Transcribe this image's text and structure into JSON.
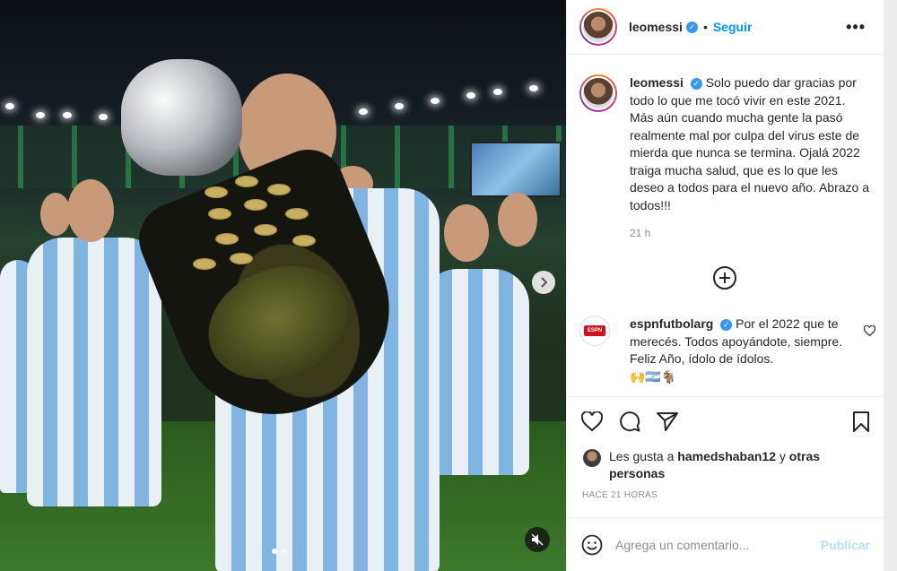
{
  "post": {
    "username": "leomessi",
    "follow_label": "Seguir",
    "bullet": "•",
    "more_label": "•••",
    "caption": "Solo puedo dar gracias por todo lo que me tocó vivir en este 2021. Más aún cuando mucha gente la pasó realmente mal por culpa del virus este de mierda que nunca se termina. Ojalá 2022 traiga mucha salud, que es lo que les deseo a todos para el nuevo año. Abrazo a todos!!!",
    "caption_time": "21 h"
  },
  "comment": {
    "username": "espnfutbolarg",
    "text": "Por el 2022 que te merecés. Todos apoyándote, siempre. Feliz Año, ídolo de ídolos.",
    "emojis": "🙌🇦🇷🐐",
    "logo_text": "ESPN"
  },
  "likes": {
    "prefix": "Les gusta a",
    "user": "hamedshaban12",
    "and": "y",
    "others": "otras personas"
  },
  "timestamp": "HACE 21 HORAS",
  "comment_box": {
    "placeholder": "Agrega un comentario...",
    "publish_label": "Publicar"
  },
  "carousel": {
    "slide_count": 2,
    "active_slide": 1
  },
  "colors": {
    "accent": "#0095f6",
    "verified": "#3897f0",
    "publish_disabled": "#b2dffc",
    "muted_text": "#8e8e8e"
  },
  "icons": [
    "plus-circle-icon",
    "heart-icon",
    "comment-icon",
    "share-icon",
    "bookmark-icon",
    "emoji-icon",
    "chevron-right-icon",
    "mute-icon",
    "verified-icon"
  ]
}
